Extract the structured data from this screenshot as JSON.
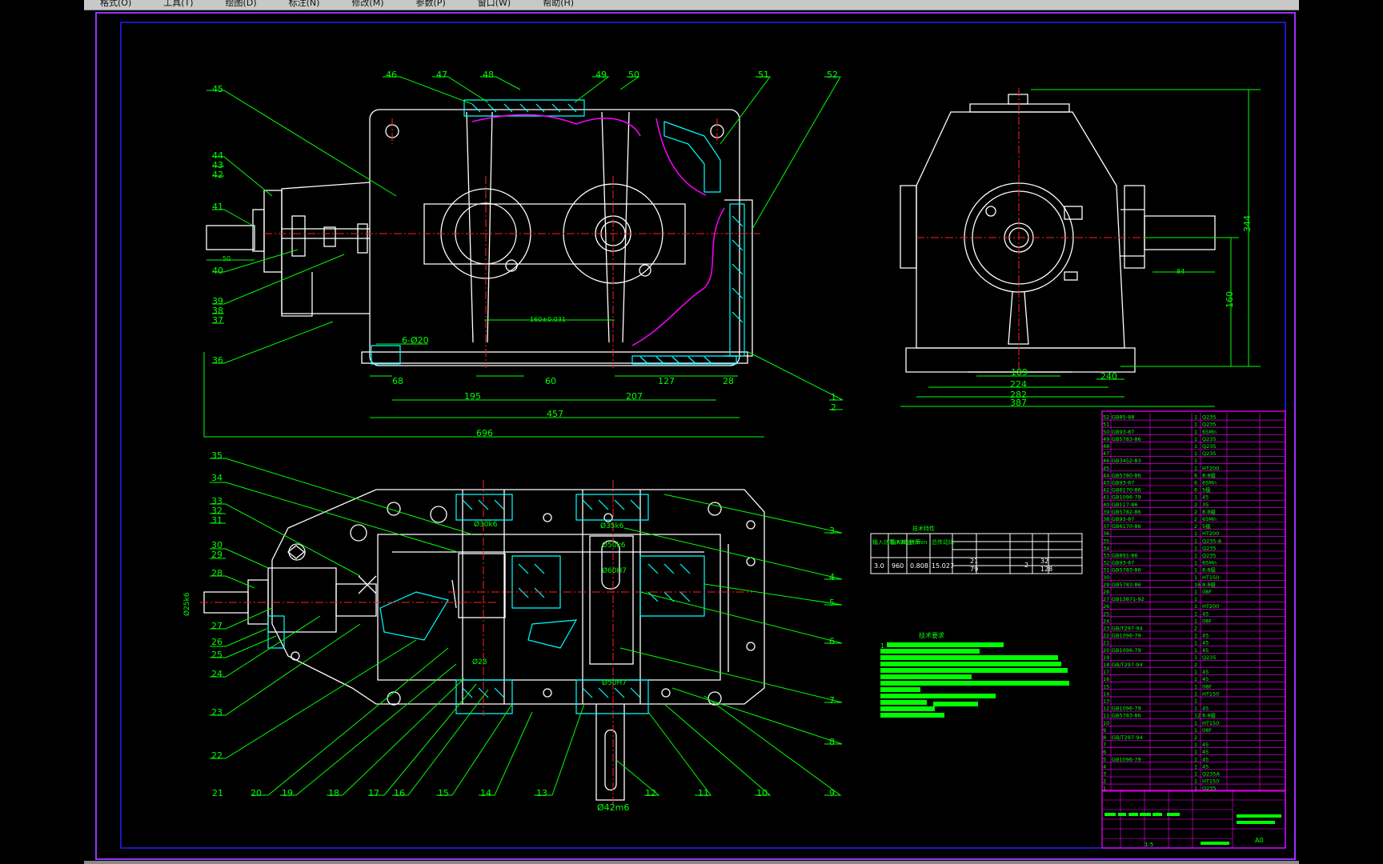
{
  "menubar": {
    "items": [
      "格式(O)",
      "工具(T)",
      "绘图(D)",
      "标注(N)",
      "修改(M)",
      "参数(P)",
      "窗口(W)",
      "帮助(H)"
    ]
  },
  "colors": {
    "background": "#000000",
    "outline": "#ffffff",
    "leader": "#00ff00",
    "hatch": "#00ffff",
    "center": "#ff2020",
    "break": "#ff00ff",
    "frame": "#8a2be2"
  },
  "front_view": {
    "dims": {
      "d68": "68",
      "d60": "60",
      "d28": "28",
      "d195": "195",
      "d207": "207",
      "d127": "127",
      "d457": "457",
      "d696": "696",
      "d50": "50",
      "d160": "160±0.031",
      "d6": "6-Ø20"
    },
    "labels": [
      "45",
      "44",
      "43",
      "42",
      "41",
      "40",
      "39",
      "38",
      "37",
      "36",
      "46",
      "47",
      "48",
      "49",
      "50",
      "51",
      "52",
      "1",
      "2"
    ]
  },
  "side_view": {
    "dims": {
      "h344": "344",
      "h160": "160",
      "d189": "189",
      "d224": "224",
      "d282": "282",
      "d387": "387",
      "d240": "240",
      "d84": "84"
    }
  },
  "top_view": {
    "dims": {
      "phi30": "Ø30k6",
      "phi35": "Ø35k6",
      "phi50": "Ø50k6",
      "phi60": "Ø60H7",
      "phi42": "Ø42m6",
      "phi25": "Ø25k6",
      "phi28": "Ø28",
      "phi50h7": "Ø50H7"
    },
    "labels_left": [
      "35",
      "34",
      "33",
      "32",
      "31",
      "30",
      "29",
      "28",
      "27",
      "26",
      "25",
      "24",
      "23",
      "22"
    ],
    "labels_bottom": [
      "21",
      "20",
      "19",
      "18",
      "17",
      "16",
      "15",
      "14",
      "13",
      "12",
      "11",
      "10",
      "9"
    ],
    "labels_right": [
      "3",
      "4",
      "5",
      "6",
      "7",
      "8"
    ]
  },
  "param_table": {
    "title": "技术特性",
    "head": [
      "输入功率/KW",
      "输入转速r/min",
      "效率",
      "总传动比"
    ],
    "values": [
      "3.0",
      "960",
      "0.808",
      "15.027"
    ],
    "extra": [
      "21",
      "79",
      "2",
      "32",
      "128"
    ]
  },
  "tech_req": {
    "title": "技术要求",
    "index": "1"
  },
  "bom": {
    "rows": [
      {
        "no": "52",
        "code": "GB85-88",
        "qty": "1",
        "mat": "Q235"
      },
      {
        "no": "51",
        "code": "",
        "qty": "1",
        "mat": "Q235"
      },
      {
        "no": "50",
        "code": "GB93-87",
        "qty": "1",
        "mat": "65Mn"
      },
      {
        "no": "49",
        "code": "GB5783-86",
        "qty": "1",
        "mat": "Q235"
      },
      {
        "no": "48",
        "code": "",
        "qty": "1",
        "mat": "Q235"
      },
      {
        "no": "47",
        "code": "",
        "qty": "1",
        "mat": "Q235"
      },
      {
        "no": "46",
        "code": "GB3452-83",
        "qty": "1",
        "mat": ""
      },
      {
        "no": "45",
        "code": "",
        "qty": "1",
        "mat": "HT200"
      },
      {
        "no": "44",
        "code": "GB5780-86",
        "qty": "6",
        "mat": "8.8级"
      },
      {
        "no": "43",
        "code": "GB93-87",
        "qty": "6",
        "mat": "65Mn"
      },
      {
        "no": "42",
        "code": "GB6170-86",
        "qty": "6",
        "mat": "5级"
      },
      {
        "no": "41",
        "code": "GB1096-79",
        "qty": "1",
        "mat": "45"
      },
      {
        "no": "40",
        "code": "GB117-86",
        "qty": "2",
        "mat": "35"
      },
      {
        "no": "39",
        "code": "GB5782-86",
        "qty": "2",
        "mat": "8.8级"
      },
      {
        "no": "38",
        "code": "GB93-87",
        "qty": "2",
        "mat": "65Mn"
      },
      {
        "no": "37",
        "code": "GB6170-86",
        "qty": "2",
        "mat": "5级"
      },
      {
        "no": "36",
        "code": "",
        "qty": "1",
        "mat": "HT200"
      },
      {
        "no": "35",
        "code": "",
        "qty": "1",
        "mat": "Q235-A"
      },
      {
        "no": "34",
        "code": "",
        "qty": "1",
        "mat": "Q235"
      },
      {
        "no": "33",
        "code": "GB891-86",
        "qty": "1",
        "mat": "Q235"
      },
      {
        "no": "32",
        "code": "GB93-87",
        "qty": "1",
        "mat": "65Mn"
      },
      {
        "no": "31",
        "code": "GB5783-86",
        "qty": "1",
        "mat": "8.8级"
      },
      {
        "no": "30",
        "code": "",
        "qty": "1",
        "mat": "HT150"
      },
      {
        "no": "29",
        "code": "GB5783-86",
        "qty": "16",
        "mat": "8.8级"
      },
      {
        "no": "28",
        "code": "",
        "qty": "1",
        "mat": "08F"
      },
      {
        "no": "27",
        "code": "GB13871-92",
        "qty": "1",
        "mat": ""
      },
      {
        "no": "26",
        "code": "",
        "qty": "1",
        "mat": "HT200"
      },
      {
        "no": "25",
        "code": "",
        "qty": "1",
        "mat": "45"
      },
      {
        "no": "24",
        "code": "",
        "qty": "1",
        "mat": "08F"
      },
      {
        "no": "23",
        "code": "GB/T297-94",
        "qty": "2",
        "mat": ""
      },
      {
        "no": "22",
        "code": "GB1096-79",
        "qty": "1",
        "mat": "45"
      },
      {
        "no": "21",
        "code": "",
        "qty": "1",
        "mat": "45"
      },
      {
        "no": "20",
        "code": "GB1096-79",
        "qty": "1",
        "mat": "45"
      },
      {
        "no": "19",
        "code": "",
        "qty": "1",
        "mat": "Q235"
      },
      {
        "no": "18",
        "code": "GB/T297-94",
        "qty": "2",
        "mat": ""
      },
      {
        "no": "17",
        "code": "",
        "qty": "1",
        "mat": "45"
      },
      {
        "no": "16",
        "code": "",
        "qty": "1",
        "mat": "45"
      },
      {
        "no": "15",
        "code": "",
        "qty": "1",
        "mat": "08F"
      },
      {
        "no": "14",
        "code": "",
        "qty": "1",
        "mat": "HT150"
      },
      {
        "no": "13",
        "code": "",
        "qty": "1",
        "mat": ""
      },
      {
        "no": "12",
        "code": "GB1096-79",
        "qty": "1",
        "mat": "45"
      },
      {
        "no": "11",
        "code": "GB5783-86",
        "qty": "12",
        "mat": "8.8级"
      },
      {
        "no": "10",
        "code": "",
        "qty": "1",
        "mat": "HT150"
      },
      {
        "no": "9",
        "code": "",
        "qty": "1",
        "mat": "08F"
      },
      {
        "no": "8",
        "code": "GB/T297-94",
        "qty": "2",
        "mat": ""
      },
      {
        "no": "7",
        "code": "",
        "qty": "1",
        "mat": "45"
      },
      {
        "no": "6",
        "code": "",
        "qty": "1",
        "mat": "45"
      },
      {
        "no": "5",
        "code": "GB1096-79",
        "qty": "1",
        "mat": "45"
      },
      {
        "no": "4",
        "code": "",
        "qty": "1",
        "mat": "45"
      },
      {
        "no": "3",
        "code": "",
        "qty": "1",
        "mat": "Q235A"
      },
      {
        "no": "2",
        "code": "",
        "qty": "1",
        "mat": "HT150"
      },
      {
        "no": "1",
        "code": "",
        "qty": "1",
        "mat": "Q235"
      }
    ],
    "sheet_no": "A0",
    "scale": "1:5"
  }
}
